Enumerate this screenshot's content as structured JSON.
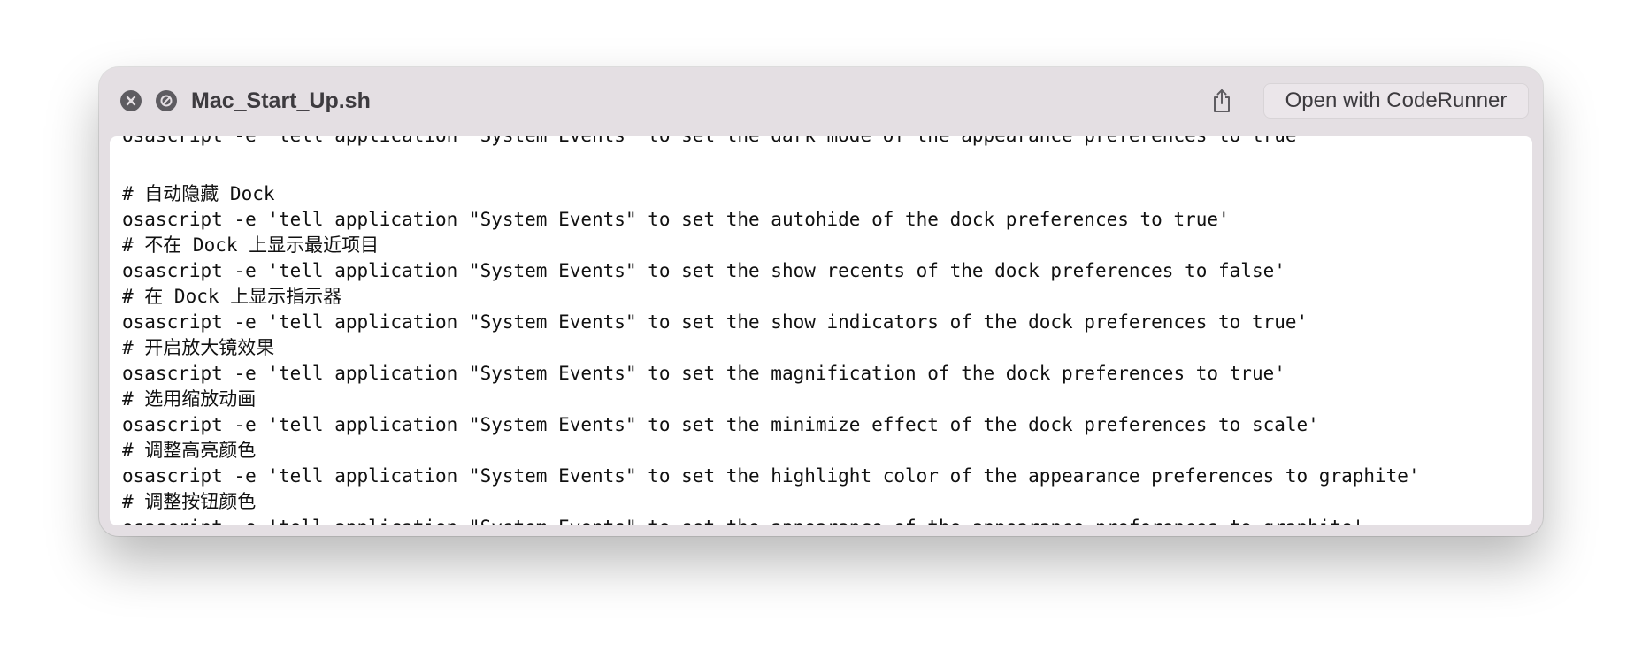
{
  "window": {
    "title": "Mac_Start_Up.sh",
    "open_button_label": "Open with CodeRunner",
    "icons": {
      "close": "close-icon",
      "minimize": "block-icon",
      "share": "share-icon"
    }
  },
  "code": {
    "clipped_top_line": "osascript -e 'tell application \"System Events\" to set the dark mode of the appearance preferences to true'",
    "lines": [
      "",
      "# 自动隐藏 Dock",
      "osascript -e 'tell application \"System Events\" to set the autohide of the dock preferences to true'",
      "# 不在 Dock 上显示最近项目",
      "osascript -e 'tell application \"System Events\" to set the show recents of the dock preferences to false'",
      "# 在 Dock 上显示指示器",
      "osascript -e 'tell application \"System Events\" to set the show indicators of the dock preferences to true'",
      "# 开启放大镜效果",
      "osascript -e 'tell application \"System Events\" to set the magnification of the dock preferences to true'",
      "# 选用缩放动画",
      "osascript -e 'tell application \"System Events\" to set the minimize effect of the dock preferences to scale'",
      "# 调整高亮颜色",
      "osascript -e 'tell application \"System Events\" to set the highlight color of the appearance preferences to graphite'",
      "# 调整按钮颜色",
      "osascript -e 'tell application \"System Events\" to set the appearance of the appearance preferences to graphite'"
    ]
  },
  "colors": {
    "titlebar_bg": "#e4dfe3",
    "text": "#111111",
    "title_text": "#3d3b3f"
  }
}
